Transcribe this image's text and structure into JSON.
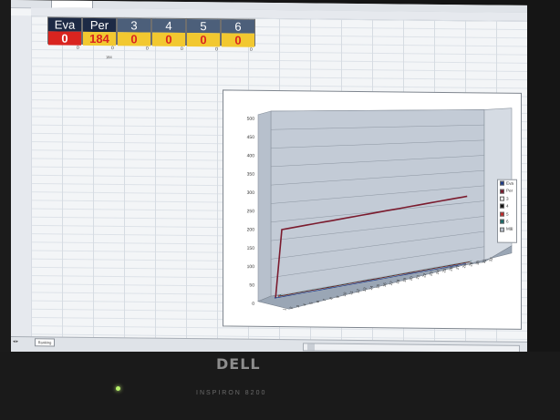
{
  "app": {
    "title": "Microsoft Excel",
    "sheet_tab": "Ranking"
  },
  "scoreboard": {
    "players": [
      {
        "name": "Eva",
        "score": "0"
      },
      {
        "name": "Per",
        "score": "184"
      },
      {
        "name": "3",
        "score": "0"
      },
      {
        "name": "4",
        "score": "0"
      },
      {
        "name": "5",
        "score": "0"
      },
      {
        "name": "6",
        "score": "0"
      }
    ],
    "row_values": [
      "0",
      "0",
      "0",
      "0",
      "0",
      "0"
    ],
    "under_value": "184"
  },
  "chart_data": {
    "type": "line",
    "title": "",
    "xlabel": "",
    "ylabel": "",
    "ylim": [
      0,
      500
    ],
    "ytick_labels": [
      "0",
      "50",
      "100",
      "150",
      "200",
      "250",
      "300",
      "350",
      "400",
      "450",
      "500"
    ],
    "x": [
      "1",
      "2",
      "3",
      "4",
      "5",
      "6",
      "7",
      "8",
      "9",
      "10",
      "11",
      "12",
      "13",
      "14",
      "15",
      "16",
      "17",
      "18",
      "19",
      "20",
      "21",
      "22",
      "23",
      "24",
      "25",
      "26",
      "27",
      "28",
      "29",
      "30",
      "31",
      "32"
    ],
    "series": [
      {
        "name": "Eva",
        "color": "#1f3c8a",
        "values": [
          0,
          0,
          0,
          0,
          0,
          0,
          0,
          0,
          0,
          0,
          0,
          0,
          0,
          0,
          0,
          0,
          0,
          0,
          0,
          0,
          0,
          0,
          0,
          0,
          0,
          0,
          0,
          0,
          0,
          0,
          0,
          0
        ]
      },
      {
        "name": "Per",
        "color": "#7b1b2e",
        "values": [
          0,
          184,
          184,
          184,
          184,
          184,
          184,
          184,
          184,
          184,
          184,
          184,
          184,
          184,
          184,
          184,
          184,
          184,
          184,
          184,
          184,
          184,
          184,
          184,
          184,
          184,
          184,
          184,
          184,
          184,
          184,
          184
        ]
      },
      {
        "name": "3",
        "color": "#ececec",
        "values": [
          0,
          0,
          0,
          0,
          0,
          0,
          0,
          0,
          0,
          0,
          0,
          0,
          0,
          0,
          0,
          0,
          0,
          0,
          0,
          0,
          0,
          0,
          0,
          0,
          0,
          0,
          0,
          0,
          0,
          0,
          0,
          0
        ]
      },
      {
        "name": "4",
        "color": "#111111",
        "values": [
          0,
          0,
          0,
          0,
          0,
          0,
          0,
          0,
          0,
          0,
          0,
          0,
          0,
          0,
          0,
          0,
          0,
          0,
          0,
          0,
          0,
          0,
          0,
          0,
          0,
          0,
          0,
          0,
          0,
          0,
          0,
          0
        ]
      },
      {
        "name": "5",
        "color": "#c42a2a",
        "values": [
          0,
          0,
          0,
          0,
          0,
          0,
          0,
          0,
          0,
          0,
          0,
          0,
          0,
          0,
          0,
          0,
          0,
          0,
          0,
          0,
          0,
          0,
          0,
          0,
          0,
          0,
          0,
          0,
          0,
          0,
          0,
          0
        ]
      },
      {
        "name": "6",
        "color": "#1b6b6b",
        "values": [
          0,
          0,
          0,
          0,
          0,
          0,
          0,
          0,
          0,
          0,
          0,
          0,
          0,
          0,
          0,
          0,
          0,
          0,
          0,
          0,
          0,
          0,
          0,
          0,
          0,
          0,
          0,
          0,
          0,
          0,
          0,
          0
        ]
      },
      {
        "name": "Mål",
        "color": "#b9c1cc",
        "values": [
          0,
          0,
          0,
          0,
          0,
          0,
          0,
          0,
          0,
          0,
          0,
          0,
          0,
          0,
          0,
          0,
          0,
          0,
          0,
          0,
          0,
          0,
          0,
          0,
          0,
          0,
          0,
          0,
          0,
          0,
          0,
          0
        ]
      }
    ],
    "grid": true,
    "legend": "right"
  },
  "hardware": {
    "brand": "DELL",
    "model": "INSPIRON 8200"
  }
}
